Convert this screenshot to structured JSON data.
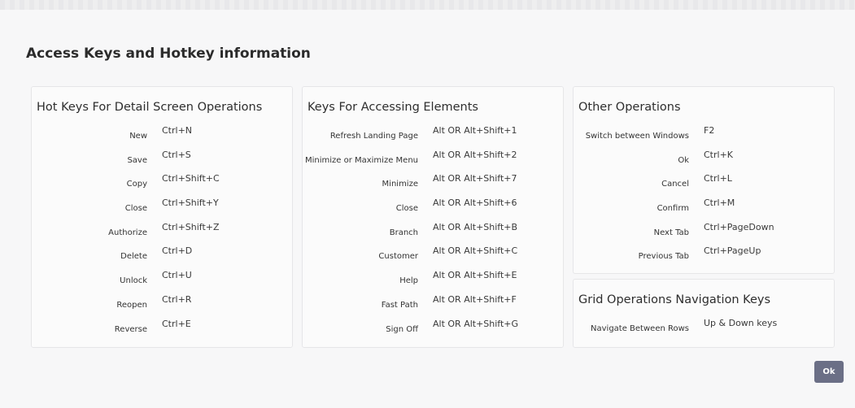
{
  "title": "Access Keys and Hotkey information",
  "panels": {
    "detail": {
      "heading": "Hot Keys For Detail Screen Operations",
      "rows": [
        {
          "label": "New",
          "key": "Ctrl+N"
        },
        {
          "label": "Save",
          "key": "Ctrl+S"
        },
        {
          "label": "Copy",
          "key": "Ctrl+Shift+C"
        },
        {
          "label": "Close",
          "key": "Ctrl+Shift+Y"
        },
        {
          "label": "Authorize",
          "key": "Ctrl+Shift+Z"
        },
        {
          "label": "Delete",
          "key": "Ctrl+D"
        },
        {
          "label": "Unlock",
          "key": "Ctrl+U"
        },
        {
          "label": "Reopen",
          "key": "Ctrl+R"
        },
        {
          "label": "Reverse",
          "key": "Ctrl+E"
        }
      ]
    },
    "elements": {
      "heading": "Keys For Accessing Elements",
      "rows": [
        {
          "label": "Refresh Landing Page",
          "key": "Alt OR Alt+Shift+1"
        },
        {
          "label": "Minimize or Maximize Menu",
          "key": "Alt OR Alt+Shift+2"
        },
        {
          "label": "Minimize",
          "key": "Alt OR Alt+Shift+7"
        },
        {
          "label": "Close",
          "key": "Alt OR Alt+Shift+6"
        },
        {
          "label": "Branch",
          "key": "Alt OR Alt+Shift+B"
        },
        {
          "label": "Customer",
          "key": "Alt OR Alt+Shift+C"
        },
        {
          "label": "Help",
          "key": "Alt OR Alt+Shift+E"
        },
        {
          "label": "Fast Path",
          "key": "Alt OR Alt+Shift+F"
        },
        {
          "label": "Sign Off",
          "key": "Alt OR Alt+Shift+G"
        }
      ]
    },
    "other": {
      "heading": "Other Operations",
      "rows": [
        {
          "label": "Switch between Windows",
          "key": "F2"
        },
        {
          "label": "Ok",
          "key": "Ctrl+K"
        },
        {
          "label": "Cancel",
          "key": "Ctrl+L"
        },
        {
          "label": "Confirm",
          "key": "Ctrl+M"
        },
        {
          "label": "Next Tab",
          "key": "Ctrl+PageDown"
        },
        {
          "label": "Previous Tab",
          "key": "Ctrl+PageUp"
        }
      ]
    },
    "grid": {
      "heading": "Grid Operations Navigation Keys",
      "rows": [
        {
          "label": "Navigate Between Rows",
          "key": "Up & Down keys"
        }
      ]
    }
  },
  "ok_button": "Ok",
  "colors": {
    "button_bg": "#6b6f86",
    "panel_border": "#e6e6e8",
    "page_bg": "#f7f7f8"
  }
}
